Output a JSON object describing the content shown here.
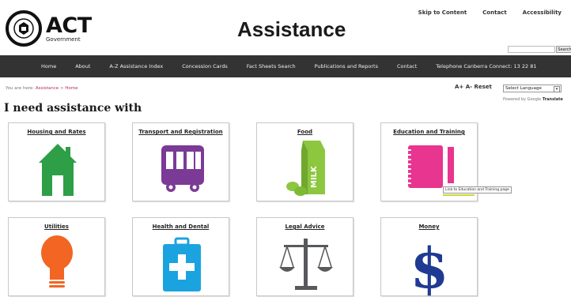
{
  "logo": {
    "name": "ACT",
    "sub": "Government"
  },
  "page_title": "Assistance",
  "top_links": [
    "Skip to Content",
    "Contact",
    "Accessibility"
  ],
  "search": {
    "button": "Search"
  },
  "nav": [
    "Home",
    "About",
    "A-Z Assistance Index",
    "Concession Cards",
    "Fact Sheets Search",
    "Publications and Reports",
    "Contact",
    "Telephone Canberra Connect: 13 22 81"
  ],
  "breadcrumb": {
    "prefix": "You are here:",
    "link": "Assistance",
    "separator": ">",
    "current": "Home"
  },
  "text_size": "A+ A- Reset",
  "language": {
    "selected": "Select Language",
    "powered_by": "Powered by",
    "google": "Google",
    "translate": "Translate"
  },
  "heading": "I need assistance with",
  "tiles": [
    {
      "label": "Housing and Rates",
      "icon": "house-icon",
      "color": "#2e9e47"
    },
    {
      "label": "Transport and Registration",
      "icon": "bus-icon",
      "color": "#7b3a96"
    },
    {
      "label": "Food",
      "icon": "milk-icon",
      "color": "#8dc63f"
    },
    {
      "label": "Education and Training",
      "icon": "notebook-icon",
      "color": "#e8358f"
    },
    {
      "label": "Utilities",
      "icon": "lightbulb-icon",
      "color": "#f26522"
    },
    {
      "label": "Health and Dental",
      "icon": "first-aid-kit-icon",
      "color": "#1ba3e0"
    },
    {
      "label": "Legal Advice",
      "icon": "scales-icon",
      "color": "#58595b"
    },
    {
      "label": "Money",
      "icon": "dollar-icon",
      "color": "#1f3a93"
    }
  ],
  "tooltip": "Link to Education and Training page",
  "milk_text": "MILK"
}
